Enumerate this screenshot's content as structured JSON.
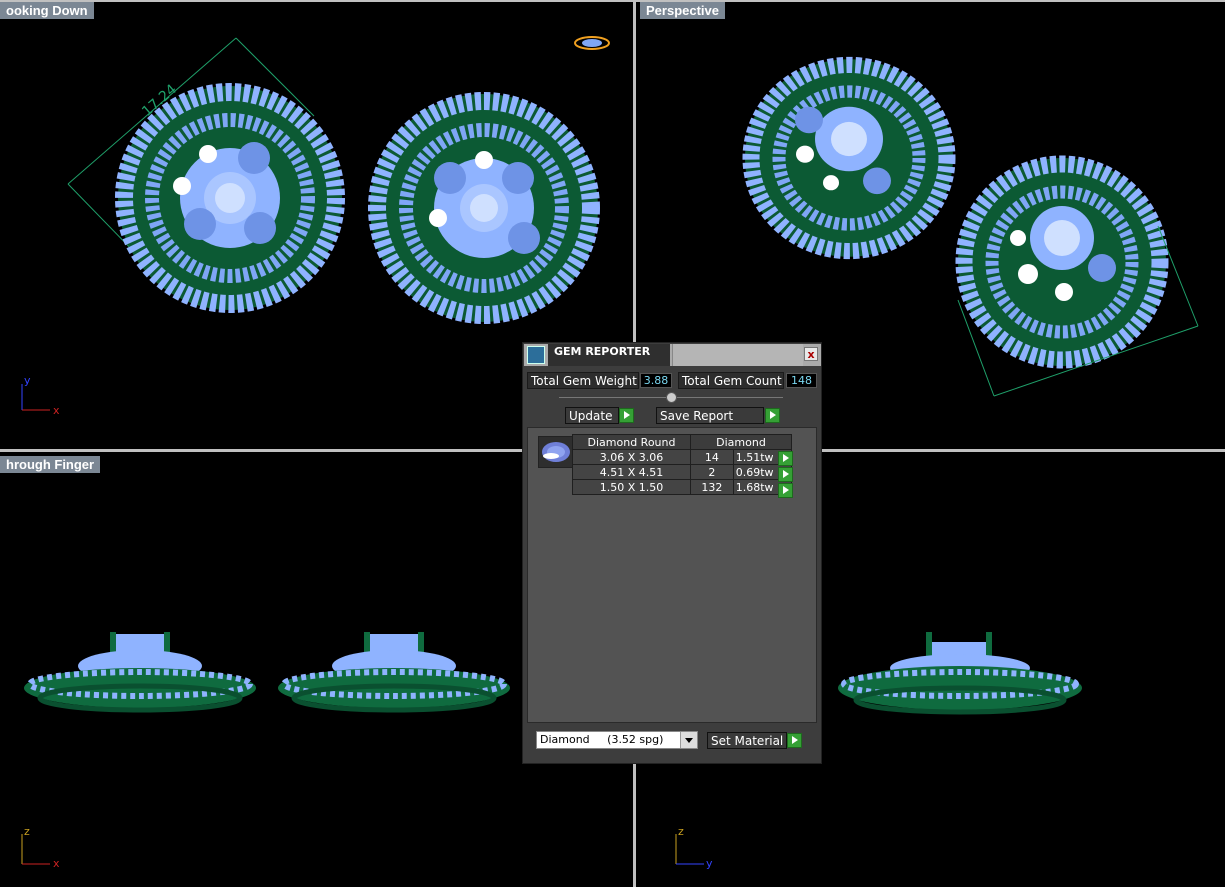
{
  "viewports": {
    "top_left": {
      "label": "ooking Down",
      "dimension": "17.24",
      "axis_v": "y",
      "axis_h": "x"
    },
    "top_right": {
      "label": "Perspective"
    },
    "bottom_left": {
      "label": "hrough Finger",
      "axis_v": "z",
      "axis_h": "x"
    },
    "bottom_right": {
      "axis_v": "z",
      "axis_h": "y"
    }
  },
  "gem_reporter": {
    "title": "GEM REPORTER",
    "close_label": "x",
    "total_weight_label": "Total Gem Weight",
    "total_weight_value": "3.88",
    "total_count_label": "Total Gem Count",
    "total_count_value": "148",
    "update_label": "Update",
    "save_report_label": "Save Report",
    "table": {
      "header_shape": "Diamond Round",
      "header_material": "Diamond",
      "rows": [
        {
          "size": "3.06 X 3.06",
          "count": "14",
          "weight": "1.51tw"
        },
        {
          "size": "4.51 X 4.51",
          "count": "2",
          "weight": "0.69tw"
        },
        {
          "size": "1.50 X 1.50",
          "count": "132",
          "weight": "1.68tw"
        }
      ]
    },
    "material_select": "Diamond     (3.52 spg)",
    "set_material_label": "Set Material"
  },
  "colors": {
    "gem": "#8fb3ff",
    "gem_dark": "#4a6fc7",
    "metal": "#0f6b3f",
    "panel_bg": "#3d3d3d",
    "accent_green": "#35a035",
    "value_text": "#7ad7f0"
  }
}
